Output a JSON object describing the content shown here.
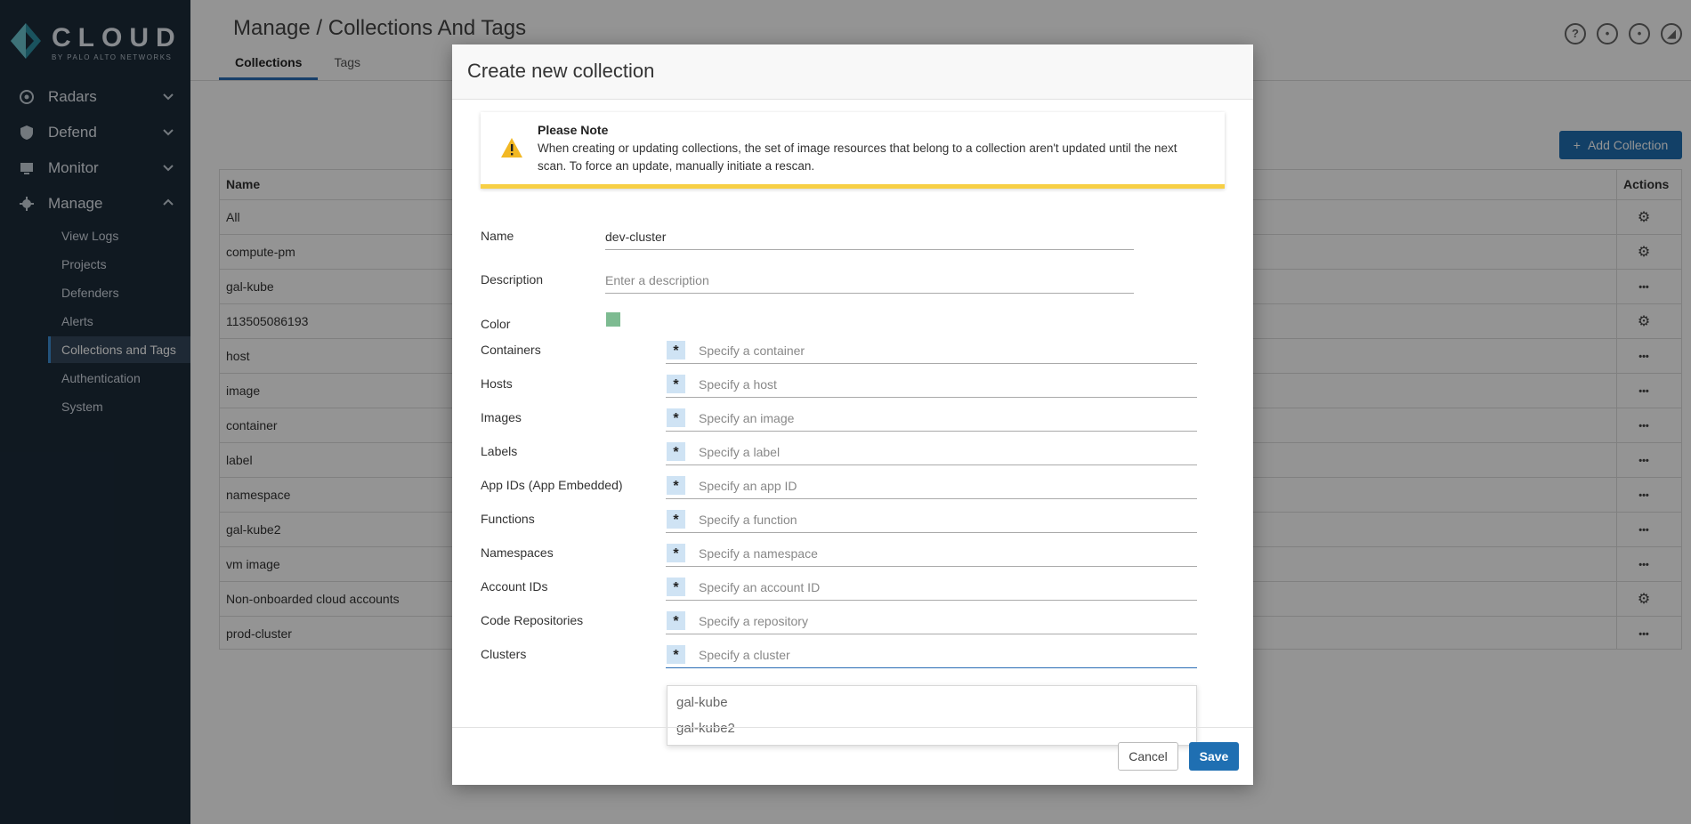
{
  "brand": {
    "word": "CLOUD",
    "sub": "BY PALO ALTO NETWORKS"
  },
  "sidebar": {
    "collapse_glyph": "‹",
    "sections": [
      {
        "label": "Radars",
        "icon": "radar-icon"
      },
      {
        "label": "Defend",
        "icon": "shield-icon"
      },
      {
        "label": "Monitor",
        "icon": "monitor-icon"
      },
      {
        "label": "Manage",
        "icon": "gear-icon"
      }
    ],
    "manage_items": [
      {
        "label": "View Logs"
      },
      {
        "label": "Projects"
      },
      {
        "label": "Defenders"
      },
      {
        "label": "Alerts"
      },
      {
        "label": "Collections and Tags",
        "active": true
      },
      {
        "label": "Authentication"
      },
      {
        "label": "System"
      }
    ]
  },
  "header": {
    "title": "Manage / Collections And Tags",
    "tabs": [
      {
        "label": "Collections",
        "active": true
      },
      {
        "label": "Tags"
      }
    ],
    "icons": [
      "help-icon",
      "bell-icon",
      "user-icon",
      "signal-icon"
    ],
    "help_glyph": "?"
  },
  "main": {
    "add_button": "Add Collection",
    "columns": {
      "name": "Name",
      "actions": "Actions"
    },
    "rows": [
      {
        "name": "All",
        "action": "gear"
      },
      {
        "name": "compute-pm",
        "action": "gear"
      },
      {
        "name": "gal-kube",
        "action": "more"
      },
      {
        "name": "113505086193",
        "action": "gear"
      },
      {
        "name": "host",
        "action": "more"
      },
      {
        "name": "image",
        "action": "more"
      },
      {
        "name": "container",
        "action": "more"
      },
      {
        "name": "label",
        "action": "more"
      },
      {
        "name": "namespace",
        "action": "more"
      },
      {
        "name": "gal-kube2",
        "action": "more"
      },
      {
        "name": "vm image",
        "action": "more"
      },
      {
        "name": "Non-onboarded cloud accounts",
        "action": "gear"
      },
      {
        "name": "prod-cluster",
        "action": "more"
      }
    ]
  },
  "modal": {
    "title": "Create new collection",
    "note": {
      "title": "Please Note",
      "text": "When creating or updating collections, the set of image resources that belong to a collection aren't updated until the next scan. To force an update, manually initiate a rescan."
    },
    "name": {
      "label": "Name",
      "value": "dev-cluster"
    },
    "description": {
      "label": "Description",
      "placeholder": "Enter a description"
    },
    "color": {
      "label": "Color",
      "value": "#7dbb91"
    },
    "wildcard": "*",
    "fields": [
      {
        "label": "Containers",
        "placeholder": "Specify a container"
      },
      {
        "label": "Hosts",
        "placeholder": "Specify a host"
      },
      {
        "label": "Images",
        "placeholder": "Specify an image"
      },
      {
        "label": "Labels",
        "placeholder": "Specify a label"
      },
      {
        "label": "App IDs (App Embedded)",
        "placeholder": "Specify an app ID"
      },
      {
        "label": "Functions",
        "placeholder": "Specify a function"
      },
      {
        "label": "Namespaces",
        "placeholder": "Specify a namespace"
      },
      {
        "label": "Account IDs",
        "placeholder": "Specify an account ID"
      },
      {
        "label": "Code Repositories",
        "placeholder": "Specify a repository"
      },
      {
        "label": "Clusters",
        "placeholder": "Specify a cluster",
        "focused": true
      }
    ],
    "cluster_suggestions": [
      "gal-kube",
      "gal-kube2"
    ],
    "cancel": "Cancel",
    "save": "Save"
  }
}
